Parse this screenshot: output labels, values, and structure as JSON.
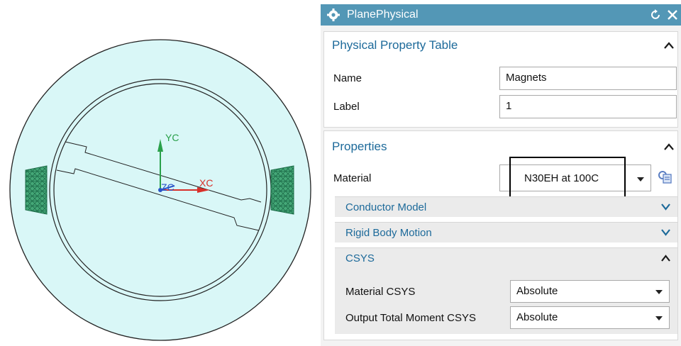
{
  "viewport": {
    "axis_labels": {
      "y": "YC",
      "x": "XC",
      "z": "ZC"
    }
  },
  "dialog": {
    "title": "PlanePhysical",
    "sections": {
      "ppt": {
        "title": "Physical Property Table",
        "name_label": "Name",
        "name_value": "Magnets",
        "label_label": "Label",
        "label_value": "1"
      },
      "props": {
        "title": "Properties",
        "material_label": "Material",
        "material_value": "N30EH at 100C",
        "conductor_model": "Conductor Model",
        "rigid_body_motion": "Rigid Body Motion",
        "csys": {
          "title": "CSYS",
          "material_csys_label": "Material CSYS",
          "material_csys_value": "Absolute",
          "output_label": "Output Total Moment CSYS",
          "output_value": "Absolute"
        }
      }
    }
  },
  "colors": {
    "title_bar": "#5397b6",
    "section_title": "#1d6a9a",
    "mesh_fill": "#d9f7f7",
    "magnet": "#3a9c6e",
    "axis_x": "#d8302a",
    "axis_y": "#2aa04a"
  },
  "icons": [
    "gear-icon",
    "reset-icon",
    "close-icon",
    "chevron-up-icon",
    "chevron-down-icon",
    "material-library-icon"
  ]
}
